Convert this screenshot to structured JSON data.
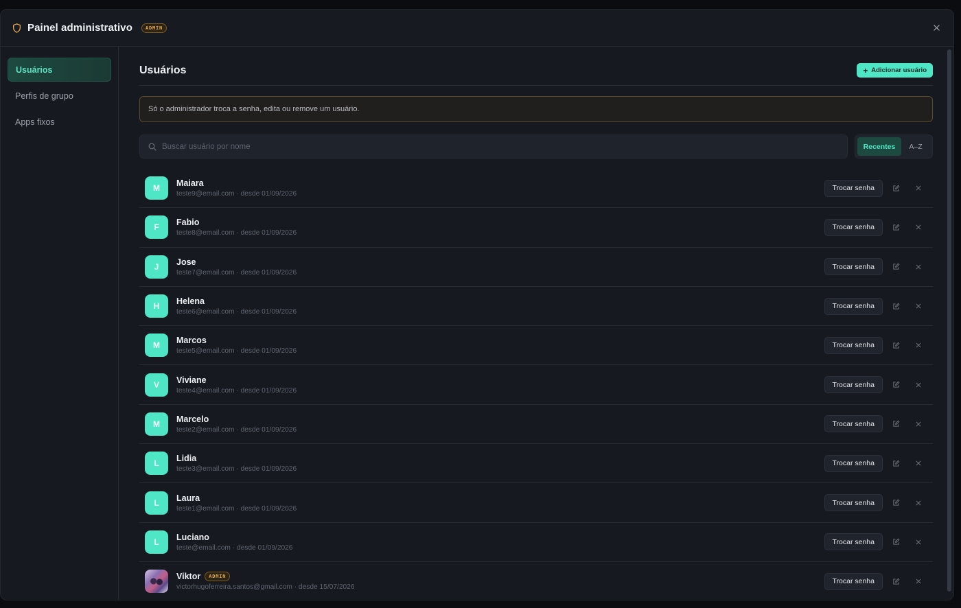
{
  "window": {
    "title": "Painel administrativo",
    "badge": "ADMIN"
  },
  "sidebar": {
    "items": [
      {
        "label": "Usuários",
        "active": true
      },
      {
        "label": "Perfis de grupo",
        "active": false
      },
      {
        "label": "Apps fixos",
        "active": false
      }
    ]
  },
  "main": {
    "title": "Usuários",
    "add_button": "Adicionar usuário",
    "notice": "Só o administrador troca a senha, edita ou remove um usuário.",
    "search": {
      "placeholder": "Buscar usuário por nome",
      "value": ""
    },
    "sort": {
      "options": [
        "Recentes",
        "A–Z"
      ],
      "selected": "Recentes"
    },
    "password_button": "Trocar senha"
  },
  "users": [
    {
      "initial": "M",
      "name": "Maiara",
      "meta": "teste9@email.com · desde 01/09/2026"
    },
    {
      "initial": "F",
      "name": "Fabio",
      "meta": "teste8@email.com · desde 01/09/2026"
    },
    {
      "initial": "J",
      "name": "Jose",
      "meta": "teste7@email.com · desde 01/09/2026"
    },
    {
      "initial": "H",
      "name": "Helena",
      "meta": "teste6@email.com · desde 01/09/2026"
    },
    {
      "initial": "M",
      "name": "Marcos",
      "meta": "teste5@email.com · desde 01/09/2026"
    },
    {
      "initial": "V",
      "name": "Viviane",
      "meta": "teste4@email.com · desde 01/09/2026"
    },
    {
      "initial": "M",
      "name": "Marcelo",
      "meta": "teste2@email.com · desde 01/09/2026"
    },
    {
      "initial": "L",
      "name": "Lidia",
      "meta": "teste3@email.com · desde 01/09/2026"
    },
    {
      "initial": "L",
      "name": "Laura",
      "meta": "teste1@email.com · desde 01/09/2026"
    },
    {
      "initial": "L",
      "name": "Luciano",
      "meta": "teste@email.com · desde 01/09/2026"
    },
    {
      "initial": "",
      "name": "Viktor",
      "badge": "ADMIN",
      "meta": "victorhugoferreira.santos@gmail.com · desde 15/07/2026",
      "photo": true
    }
  ],
  "colors": {
    "accent": "#4ee6c4",
    "admin_badge": "#e0a84d",
    "background": "#161920"
  },
  "icons": {
    "title": "shield-icon",
    "close": "close-icon",
    "search": "search-icon",
    "add": "plus-icon",
    "edit": "edit-icon",
    "delete": "close-icon"
  }
}
